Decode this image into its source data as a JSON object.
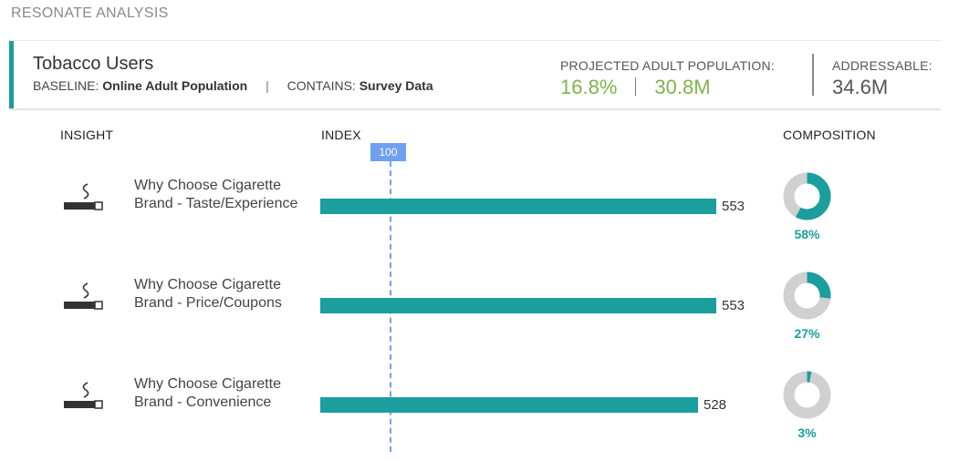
{
  "app": {
    "title": "RESONATE ANALYSIS"
  },
  "segment": {
    "name": "Tobacco Users",
    "baseline_label": "BASELINE:",
    "baseline_value": "Online Adult Population",
    "separator": "|",
    "contains_label": "CONTAINS:",
    "contains_value": "Survey Data"
  },
  "projected": {
    "label": "PROJECTED ADULT POPULATION:",
    "percent": "16.8%",
    "count": "30.8M"
  },
  "addressable": {
    "label": "ADDRESSABLE:",
    "count": "34.6M"
  },
  "columns": {
    "insight": "INSIGHT",
    "index": "INDEX",
    "composition": "COMPOSITION"
  },
  "reference": {
    "label": "100",
    "value": 100
  },
  "colors": {
    "accent": "#1a9e9e",
    "green": "#7ab648",
    "reference": "#6fa1f0",
    "donut_bg": "#d0d0d0"
  },
  "rows": [
    {
      "icon": "cigarette-icon",
      "insight": "Why Choose Cigarette Brand - Taste/Experience",
      "index": 553,
      "index_label": "553",
      "composition": 0.58,
      "composition_label": "58%"
    },
    {
      "icon": "cigarette-icon",
      "insight": "Why Choose Cigarette Brand - Price/Coupons",
      "index": 553,
      "index_label": "553",
      "composition": 0.27,
      "composition_label": "27%"
    },
    {
      "icon": "cigarette-icon",
      "insight": "Why Choose Cigarette Brand - Convenience",
      "index": 528,
      "index_label": "528",
      "composition": 0.03,
      "composition_label": "3%"
    }
  ]
}
